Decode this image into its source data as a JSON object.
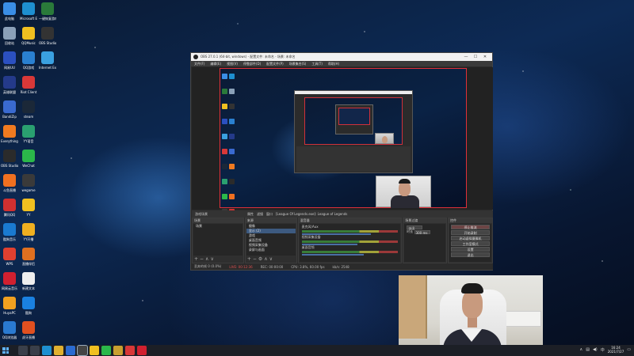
{
  "desktop": {
    "icons": [
      {
        "label": "此电脑",
        "color": "#3a8ee6",
        "col": 0,
        "row": 0
      },
      {
        "label": "Microsoft Edge",
        "color": "#1e8fd0",
        "col": 1,
        "row": 0
      },
      {
        "label": "一键恢复游戏",
        "color": "#2a7a3a",
        "col": 2,
        "row": 0
      },
      {
        "label": "回收站",
        "color": "#8aa0b8",
        "col": 0,
        "row": 1
      },
      {
        "label": "QQMusic",
        "color": "#f0c020",
        "col": 1,
        "row": 1
      },
      {
        "label": "OBS Studio",
        "color": "#333333",
        "col": 2,
        "row": 1
      },
      {
        "label": "网易UU",
        "color": "#2b50c0",
        "col": 0,
        "row": 2
      },
      {
        "label": "QQ游戏",
        "color": "#2a80d0",
        "col": 1,
        "row": 2
      },
      {
        "label": "Internet Explorer",
        "color": "#3aa0e0",
        "col": 2,
        "row": 2
      },
      {
        "label": "英雄联盟",
        "color": "#243a8a",
        "col": 0,
        "row": 3
      },
      {
        "label": "Riot Client",
        "color": "#d83838",
        "col": 1,
        "row": 3
      },
      {
        "label": "BandiZip",
        "color": "#3a6ad0",
        "col": 0,
        "row": 4
      },
      {
        "label": "steam",
        "color": "#1b2838",
        "col": 1,
        "row": 4
      },
      {
        "label": "Everything",
        "color": "#f07a20",
        "col": 0,
        "row": 5
      },
      {
        "label": "YY语音",
        "color": "#2aa070",
        "col": 1,
        "row": 5
      },
      {
        "label": "OBS Studio",
        "color": "#2b2b2b",
        "col": 0,
        "row": 6
      },
      {
        "label": "WeChat",
        "color": "#2bb84a",
        "col": 1,
        "row": 6
      },
      {
        "label": "斗鱼直播",
        "color": "#f07020",
        "col": 0,
        "row": 7
      },
      {
        "label": "wegame",
        "color": "#3a3a3a",
        "col": 1,
        "row": 7
      },
      {
        "label": "腾讯QQ",
        "color": "#d03030",
        "col": 0,
        "row": 8
      },
      {
        "label": "YY",
        "color": "#f0c020",
        "col": 1,
        "row": 8
      },
      {
        "label": "酷狗音乐",
        "color": "#1a7ad0",
        "col": 0,
        "row": 9
      },
      {
        "label": "YY开播",
        "color": "#f0b020",
        "col": 1,
        "row": 9
      },
      {
        "label": "WPS",
        "color": "#e04030",
        "col": 0,
        "row": 10
      },
      {
        "label": "直播伴侣",
        "color": "#e07020",
        "col": 1,
        "row": 10
      },
      {
        "label": "网易云音乐",
        "color": "#d02030",
        "col": 0,
        "row": 11
      },
      {
        "label": "新建文本",
        "color": "#eeeeee",
        "col": 1,
        "row": 11
      },
      {
        "label": "HuyaPC",
        "color": "#f0a020",
        "col": 0,
        "row": 12
      },
      {
        "label": "酷狗",
        "color": "#1a80e0",
        "col": 1,
        "row": 12
      },
      {
        "label": "QQ浏览器",
        "color": "#2a7ad0",
        "col": 0,
        "row": 13
      },
      {
        "label": "虎牙直播",
        "color": "#e05020",
        "col": 1,
        "row": 13
      }
    ]
  },
  "obs": {
    "title": "OBS 27.0.1 (64-bit, windows) - 配置文件: 未命名 - 场景: 未命名",
    "menu": [
      "文件(F)",
      "编辑(E)",
      "视图(V)",
      "停靠部件(D)",
      "配置文件(P)",
      "场景集合(S)",
      "工具(T)",
      "帮助(H)"
    ],
    "scene_bar": {
      "current": "游戏场景",
      "props_label": "属性",
      "filter_label": "滤镜",
      "window_label": "窗口",
      "window_value": "[League Of Legends.exe]: League of Legends"
    },
    "docks": {
      "scenes": {
        "title": "场景",
        "items": [
          "场景"
        ]
      },
      "sources": {
        "title": "来源",
        "items": [
          "摄像",
          "显示 (2)",
          "游戏",
          "桌面音频",
          "视频采集设备",
          "录屏与画面"
        ]
      },
      "mixer": {
        "title": "混音器",
        "channels": [
          {
            "name": "麦克风/Aux",
            "level": 0.72
          },
          {
            "name": "视频采集设备",
            "level": 0.58
          },
          {
            "name": "桌面音频",
            "level": 0.64
          }
        ]
      },
      "transitions": {
        "title": "场景过渡",
        "type": "淡出",
        "duration_label": "时长",
        "duration": "300 ms"
      },
      "controls": {
        "title": "控件",
        "buttons": [
          "停止推流",
          "开始录制",
          "启动虚拟摄像机",
          "工作室模式",
          "设置",
          "退出"
        ]
      }
    },
    "status": {
      "dropped": "丢弃的帧 0 (0.0%)",
      "live": "LIVE: 00:12:36",
      "rec": "REC: 00:00:00",
      "cpu": "CPU: 3.8%, 60.00 fps",
      "kbps": "kb/s: 2548"
    }
  },
  "taskbar": {
    "apps": [
      {
        "name": "search",
        "color": "#3a3f4a"
      },
      {
        "name": "task-view",
        "color": "#3a3f4a"
      },
      {
        "name": "edge",
        "color": "#1e8fd0"
      },
      {
        "name": "explorer",
        "color": "#e0b030"
      },
      {
        "name": "store",
        "color": "#2a6ad0"
      },
      {
        "name": "obs",
        "color": "#444444"
      },
      {
        "name": "qq-music",
        "color": "#f0c020"
      },
      {
        "name": "wechat",
        "color": "#2bb84a"
      },
      {
        "name": "lol",
        "color": "#c8a030"
      },
      {
        "name": "riot",
        "color": "#d83838"
      },
      {
        "name": "netease-music",
        "color": "#d02030"
      }
    ],
    "clock_time": "16:24",
    "clock_date": "2021/7/27"
  }
}
